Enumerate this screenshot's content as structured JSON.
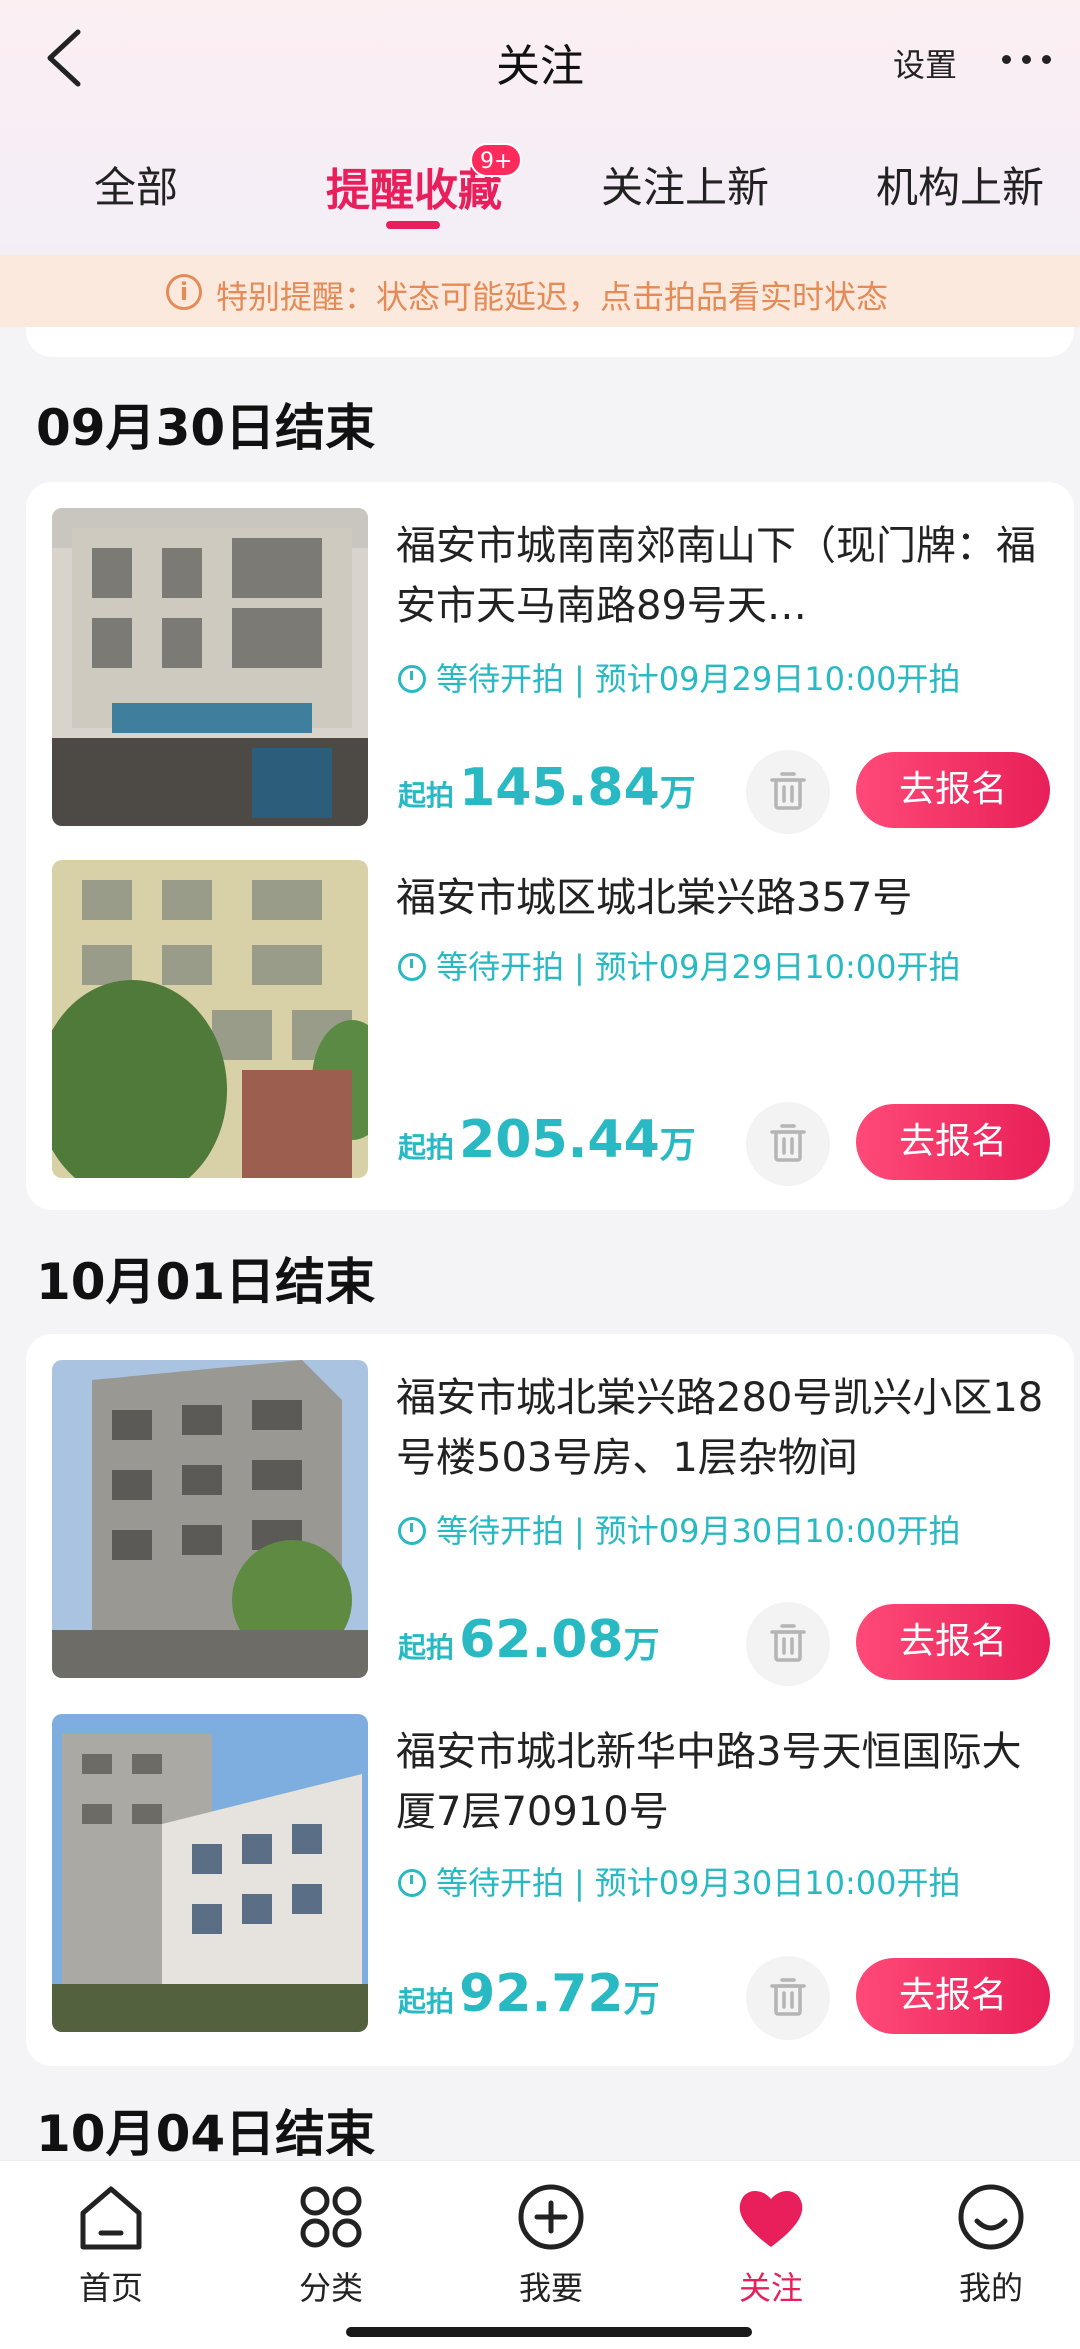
{
  "header": {
    "title": "关注",
    "settings_label": "设置"
  },
  "tabs": [
    {
      "label": "全部"
    },
    {
      "label": "提醒收藏",
      "badge": "9+"
    },
    {
      "label": "关注上新"
    },
    {
      "label": "机构上新"
    }
  ],
  "notice": {
    "icon": "info-icon",
    "text": "特别提醒：状态可能延迟，点击拍品看实时状态"
  },
  "sections": [
    {
      "title": "09月30日结束",
      "items": [
        {
          "title": "福安市城南南郊南山下（现门牌：福安市天马南路89号天…",
          "status": "等待开拍",
          "start_time": "预计09月29日10:00开拍",
          "price_prefix": "起拍",
          "price": "145.84",
          "price_unit": "万",
          "action_label": "去报名"
        },
        {
          "title": "福安市城区城北棠兴路357号",
          "status": "等待开拍",
          "start_time": "预计09月29日10:00开拍",
          "price_prefix": "起拍",
          "price": "205.44",
          "price_unit": "万",
          "action_label": "去报名"
        }
      ]
    },
    {
      "title": "10月01日结束",
      "items": [
        {
          "title": "福安市城北棠兴路280号凯兴小区18号楼503号房、1层杂物间",
          "status": "等待开拍",
          "start_time": "预计09月30日10:00开拍",
          "price_prefix": "起拍",
          "price": "62.08",
          "price_unit": "万",
          "action_label": "去报名"
        },
        {
          "title": "福安市城北新华中路3号天恒国际大厦7层70910号",
          "status": "等待开拍",
          "start_time": "预计09月30日10:00开拍",
          "price_prefix": "起拍",
          "price": "92.72",
          "price_unit": "万",
          "action_label": "去报名"
        }
      ]
    },
    {
      "title": "10月04日结束",
      "items": []
    }
  ],
  "bottom_nav": [
    {
      "label": "首页",
      "icon": "home-icon"
    },
    {
      "label": "分类",
      "icon": "category-icon"
    },
    {
      "label": "我要",
      "icon": "plus-circle-icon"
    },
    {
      "label": "关注",
      "icon": "heart-icon",
      "active": true
    },
    {
      "label": "我的",
      "icon": "smile-icon"
    }
  ],
  "colors": {
    "accent": "#e91f5b",
    "teal": "#29b9c3",
    "notice_text": "#e58b57",
    "notice_bg": "#fbe9dd"
  }
}
